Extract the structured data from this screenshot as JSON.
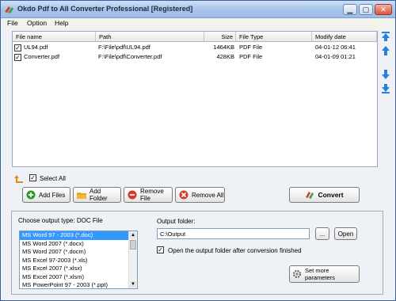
{
  "window": {
    "title": "Okdo Pdf to All Converter Professional [Registered]",
    "minimize_icon": "minimize-icon",
    "maximize_icon": "maximize-icon",
    "close_icon": "close-icon"
  },
  "menu": [
    "File",
    "Option",
    "Help"
  ],
  "filelist": {
    "columns": [
      "File name",
      "Path",
      "Size",
      "File Type",
      "Modify date"
    ],
    "rows": [
      {
        "checked": true,
        "name": "UL94.pdf",
        "path": "F:\\File\\pdf\\UL94.pdf",
        "size": "1464KB",
        "type": "PDF File",
        "date": "04-01-12 06:41"
      },
      {
        "checked": true,
        "name": "Converter.pdf",
        "path": "F:\\File\\pdf\\Converter.pdf",
        "size": "428KB",
        "type": "PDF File",
        "date": "04-01-09 01:21"
      }
    ]
  },
  "select_all": {
    "label": "Select All",
    "checked": true
  },
  "buttons": {
    "add_files": "Add Files",
    "add_folder": "Add Folder",
    "remove_file": "Remove File",
    "remove_all": "Remove All",
    "convert": "Convert",
    "browse": "...",
    "open": "Open",
    "set_params": "Set more parameters"
  },
  "output": {
    "type_label": "Choose output type:  DOC File",
    "types": [
      "MS Word 97 - 2003 (*.doc)",
      "MS Word 2007 (*.docx)",
      "MS Word 2007 (*.docm)",
      "MS Excel 97-2003 (*.xls)",
      "MS Excel 2007 (*.xlsx)",
      "MS Excel 2007 (*.xlsm)",
      "MS PowerPoint 97 - 2003 (*.ppt)"
    ],
    "selected_index": 0,
    "folder_label": "Output folder:",
    "folder_value": "C:\\Output",
    "open_after_label": "Open the output folder after conversion finished",
    "open_after_checked": true
  },
  "colors": {
    "selection": "#3399ff",
    "accent_green": "#2e9a2e",
    "accent_red": "#d23c2c",
    "accent_blue": "#2a7fd6"
  }
}
